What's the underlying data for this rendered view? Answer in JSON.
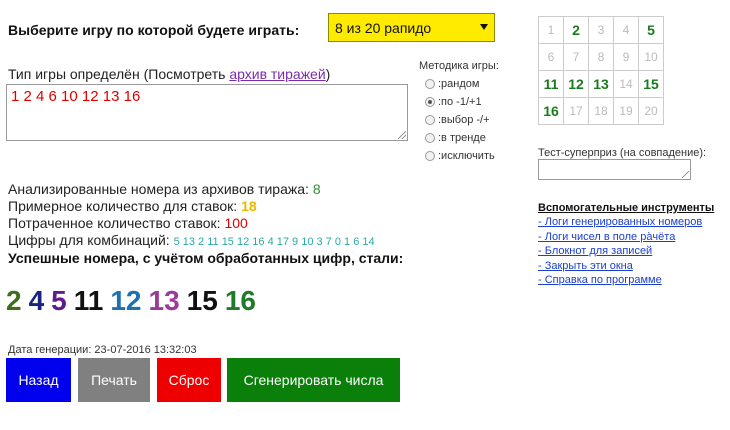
{
  "header": {
    "prompt": "Выберите игру по которой будете играть:",
    "game_select": "8 из 20 рапидо"
  },
  "game_type": {
    "label": "Тип игры определён (Посмотреть ",
    "archive_link": "архив тиражей",
    "label_end": ")",
    "input_value": "1 2 4 6 10 12 13 16"
  },
  "method": {
    "title": "Методика игры:",
    "options": [
      {
        "label": ":рандом",
        "selected": false
      },
      {
        "label": ":по -1/+1",
        "selected": true
      },
      {
        "label": ":выбор -/+",
        "selected": false
      },
      {
        "label": ":в тренде",
        "selected": false
      },
      {
        "label": ":исключить",
        "selected": false
      }
    ]
  },
  "grid": {
    "rows": [
      [
        "1",
        "2",
        "3",
        "4",
        "5"
      ],
      [
        "6",
        "7",
        "8",
        "9",
        "10"
      ],
      [
        "11",
        "12",
        "13",
        "14",
        "15"
      ],
      [
        "16",
        "17",
        "18",
        "19",
        "20"
      ]
    ],
    "highlighted": [
      "2",
      "5",
      "11",
      "12",
      "13",
      "15",
      "16"
    ]
  },
  "superprize": {
    "label": "Тест-суперприз (на совпадение):",
    "value": ""
  },
  "stats": {
    "analyzed_label": "Анализированные номера из архивов тиража: ",
    "analyzed_value": "8",
    "approx_label": "Примерное количество для ставок: ",
    "approx_value": "18",
    "spent_label": "Потраченное количество ставок: ",
    "spent_value": "100",
    "digits_label": "Цифры для комбинаций: ",
    "digits_value": "5 13 2 11 15 12 16 4 17 9 10 3 7 0 1 6 14"
  },
  "success": {
    "label": "Успешные номера, с учётом обработанных цифр, стали:",
    "numbers": [
      {
        "value": "2",
        "color": "#3c6e1e"
      },
      {
        "value": "4",
        "color": "#1a237e"
      },
      {
        "value": "5",
        "color": "#5e1a8f"
      },
      {
        "value": "11",
        "color": "#111111"
      },
      {
        "value": "12",
        "color": "#1f6fb3"
      },
      {
        "value": "13",
        "color": "#9c3a9c"
      },
      {
        "value": "15",
        "color": "#111111"
      },
      {
        "value": "16",
        "color": "#1f7a2a"
      }
    ]
  },
  "generation": {
    "date_label": "Дата генерации: 23-07-2016 13:32:03"
  },
  "buttons": {
    "back": {
      "label": "Назад",
      "color": "#0000ee"
    },
    "print": {
      "label": "Печать",
      "color": "#808080"
    },
    "reset": {
      "label": "Сброс",
      "color": "#ee0000"
    },
    "generate": {
      "label": "Сгенерировать числа",
      "color": "#0a7f0a"
    }
  },
  "aux": {
    "title": "Вспомогательные инструменты",
    "links": [
      "- Логи генерированных номеров",
      "- Логи чисел в поле ра̀чёта",
      "- Блокнот для записей",
      "- Закрыть эти окна",
      "- Справка по программе"
    ]
  }
}
